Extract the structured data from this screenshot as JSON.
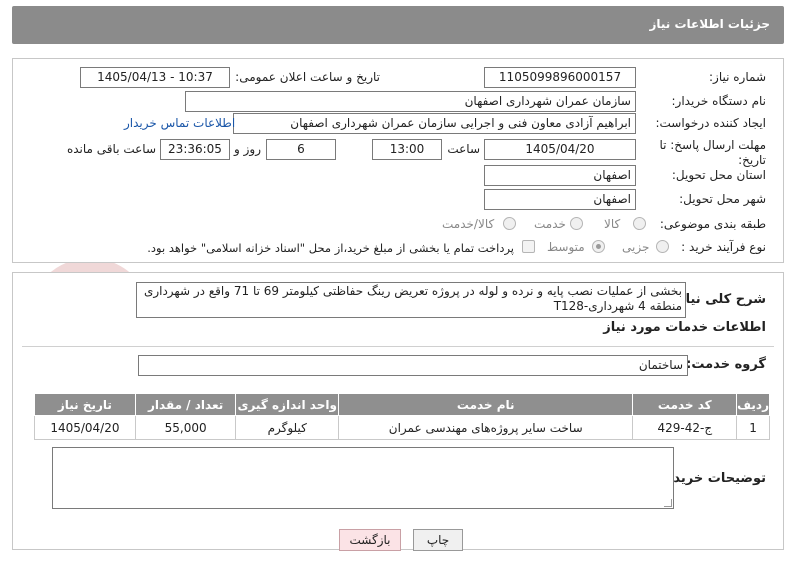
{
  "header": {
    "title": "جزئیات اطلاعات نیاز"
  },
  "form": {
    "need_number_label": "شماره نیاز:",
    "need_number": "1105099896000157",
    "announce_label": "تاریخ و ساعت اعلان عمومی:",
    "announce_value": "1405/04/13 - 10:37",
    "buyer_org_label": "نام دستگاه خریدار:",
    "buyer_org": "سازمان عمران شهرداری اصفهان",
    "creator_label": "ایجاد کننده درخواست:",
    "creator": "ابراهیم آزادی معاون فنی و اجرایی سازمان عمران شهرداری اصفهان",
    "contact_link": "اطلاعات تماس خریدار",
    "deadline_label": "مهلت ارسال پاسخ: تا تاریخ:",
    "deadline_date": "1405/04/20",
    "time_label": "ساعت",
    "deadline_time": "13:00",
    "days_value": "6",
    "days_label": "روز و",
    "remaining_time": "23:36:05",
    "remaining_label": "ساعت باقی مانده",
    "province_label": "استان محل تحویل:",
    "province": "اصفهان",
    "city_label": "شهر محل تحویل:",
    "city": "اصفهان",
    "category_label": "طبقه بندی موضوعی:",
    "category_options": [
      "کالا",
      "خدمت",
      "کالا/خدمت"
    ],
    "process_label": "نوع فرآیند خرید :",
    "process_options": [
      "جزیی",
      "متوسط"
    ],
    "payment_note": "پرداخت تمام یا بخشی از مبلغ خرید،از محل \"اسناد خزانه اسلامی\" خواهد بود."
  },
  "description": {
    "label": "شرح کلی نیاز:",
    "text": "بخشی از عملیات نصب پایه و نرده و لوله در پروژه تعریض رینگ حفاظتی کیلومتر 69 تا 71 واقع در شهرداری منطقه 4 شهرداری-T128"
  },
  "services": {
    "section_title": "اطلاعات خدمات مورد نیاز",
    "group_label": "گروه خدمت:",
    "group_value": "ساختمان",
    "columns": [
      "ردیف",
      "کد خدمت",
      "نام خدمت",
      "واحد اندازه گیری",
      "تعداد / مقدار",
      "تاریخ نیاز"
    ],
    "rows": [
      {
        "row": "1",
        "code": "ج-42-429",
        "name": "ساخت سایر پروژه‌های مهندسی عمران",
        "unit": "کیلوگرم",
        "qty": "55,000",
        "date": "1405/04/20"
      }
    ]
  },
  "buyer_notes": {
    "label": "توضیحات خریدار:",
    "value": ""
  },
  "buttons": {
    "print": "چاپ",
    "back": "بازگشت"
  },
  "watermark": {
    "text": "AriaTender.neT"
  }
}
